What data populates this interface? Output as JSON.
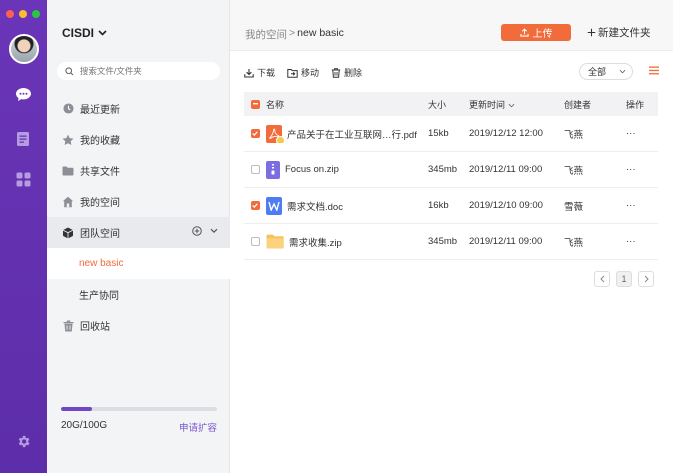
{
  "window": {
    "dot_colors": [
      "#ff5f57",
      "#febc2e",
      "#28c840"
    ]
  },
  "rail": {
    "icons": [
      "avatar",
      "chat-icon",
      "document-icon",
      "apps-icon",
      "settings-icon"
    ]
  },
  "sidebar": {
    "brand": "CISDI",
    "search_placeholder": "搜索文件/文件夹",
    "items": [
      {
        "label": "最近更新",
        "icon": "clock-icon"
      },
      {
        "label": "我的收藏",
        "icon": "star-icon"
      },
      {
        "label": "共享文件",
        "icon": "folder-icon"
      },
      {
        "label": "我的空间",
        "icon": "home-icon"
      },
      {
        "label": "团队空间",
        "icon": "cube-icon"
      },
      {
        "label": "new basic"
      },
      {
        "label": "生产协同"
      },
      {
        "label": "回收站",
        "icon": "trash-icon"
      }
    ],
    "storage": {
      "used_text": "20G/100G",
      "used_fraction": 0.2,
      "expand_label": "申请扩容"
    }
  },
  "main": {
    "breadcrumb": {
      "root": "我的空间",
      "separator": ">",
      "current": "new basic"
    },
    "upload_label": "上传",
    "new_folder_label": "新建文件夹",
    "toolbar": {
      "download": "下载",
      "move": "移动",
      "delete": "删除"
    },
    "filter": {
      "selected": "全部"
    },
    "table": {
      "headers": {
        "name": "名称",
        "size": "大小",
        "time": "更新时间",
        "author": "创建者",
        "op": "操作"
      },
      "rows": [
        {
          "name": "产品关于在工业互联网…行.pdf",
          "size": "15kb",
          "time": "2019/12/12 12:00",
          "author": "飞燕",
          "op": "···",
          "checked": true,
          "type": "pdf"
        },
        {
          "name": "Focus on.zip",
          "size": "345mb",
          "time": "2019/12/11  09:00",
          "author": "飞燕",
          "op": "···",
          "checked": false,
          "type": "zip"
        },
        {
          "name": "需求文档.doc",
          "size": "16kb",
          "time": "2019/12/10  09:00",
          "author": "雪薇",
          "op": "···",
          "checked": true,
          "type": "doc"
        },
        {
          "name": "需求收集.zip",
          "size": "345mb",
          "time": "2019/12/11  09:00",
          "author": "飞燕",
          "op": "···",
          "checked": false,
          "type": "folder"
        }
      ]
    },
    "pagination": {
      "current": "1"
    }
  },
  "colors": {
    "accent": "#f26b3a",
    "rail": "#6a35b8",
    "storage_fill": "#7048c4"
  }
}
